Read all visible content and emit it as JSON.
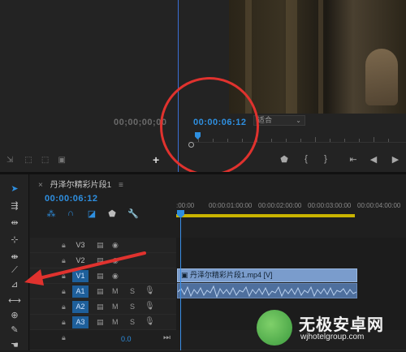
{
  "source_monitor": {
    "timecode": "00;00;00;00"
  },
  "program_monitor": {
    "timecode": "00:00:06:12",
    "fit_label": "适合",
    "add_label": "+"
  },
  "timeline": {
    "sequence_name": "丹泽尔精彩片段1",
    "close_label": "×",
    "menu_label": "≡",
    "timecode": "00:00:06:12",
    "ruler_labels": [
      ":00:00",
      "00:00:01:00:00",
      "00:00:02:00:00",
      "00:00:03:00:00",
      "00:00:04:00:00"
    ],
    "tracks": [
      {
        "name": "V3",
        "m": "",
        "s": ""
      },
      {
        "name": "V2",
        "m": "",
        "s": ""
      },
      {
        "name": "V1",
        "m": "",
        "s": ""
      },
      {
        "name": "A1",
        "m": "M",
        "s": "S"
      },
      {
        "name": "A2",
        "m": "M",
        "s": "S"
      },
      {
        "name": "A3",
        "m": "M",
        "s": "S"
      }
    ],
    "master_value": "0.0",
    "video_clip_label": "丹泽尔精彩片段1.mp4 [V]"
  },
  "watermark": {
    "brand": "无极安卓网",
    "url": "wjhotelgroup.com"
  },
  "colors": {
    "accent_blue": "#2e8fe0",
    "annotation_red": "#e0322e",
    "work_area_yellow": "#c9b400",
    "video_clip": "#7a9ccc",
    "audio_clip": "#4e6f9d"
  }
}
